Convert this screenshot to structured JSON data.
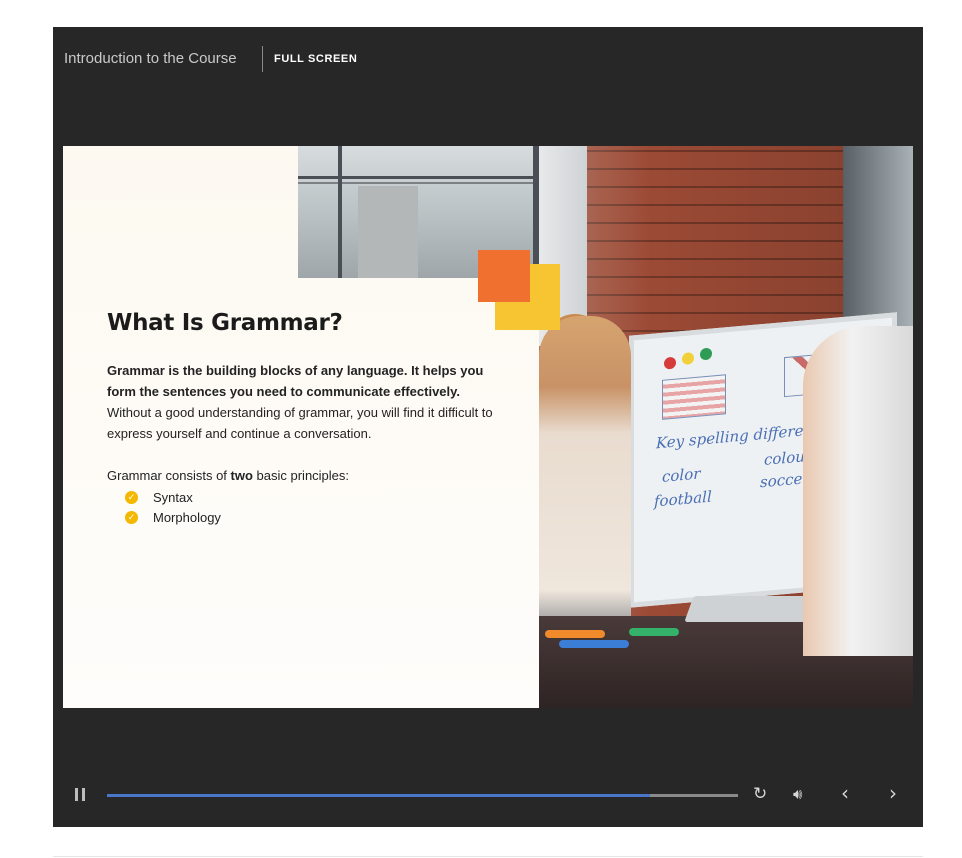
{
  "header": {
    "course_title": "Introduction to the Course",
    "fullscreen_label": "FULL SCREEN"
  },
  "slide": {
    "heading": "What Is Grammar?",
    "intro_bold": "Grammar is the building blocks of any language. It helps you form the sentences you need to communicate effectively.",
    "intro_rest": "Without a good understanding of grammar, you will find it difficult to express yourself and continue a conversation.",
    "principles_prefix": "Grammar consists of ",
    "principles_bold": "two",
    "principles_suffix": " basic principles:",
    "list_items": [
      "Syntax",
      "Morphology"
    ],
    "whiteboard": {
      "line1": "Key spelling differences",
      "line2a": "color",
      "line2b": "colour",
      "line3a": "football",
      "line3b": "soccer"
    },
    "accent_colors": {
      "orange": "#f07030",
      "yellow": "#f7c531",
      "check": "#f5b800"
    }
  },
  "controls": {
    "progress_percent": 86,
    "progress_color": "#4a76c9",
    "icons": [
      "pause-icon",
      "replay-icon",
      "volume-icon",
      "previous-icon",
      "next-icon"
    ]
  }
}
